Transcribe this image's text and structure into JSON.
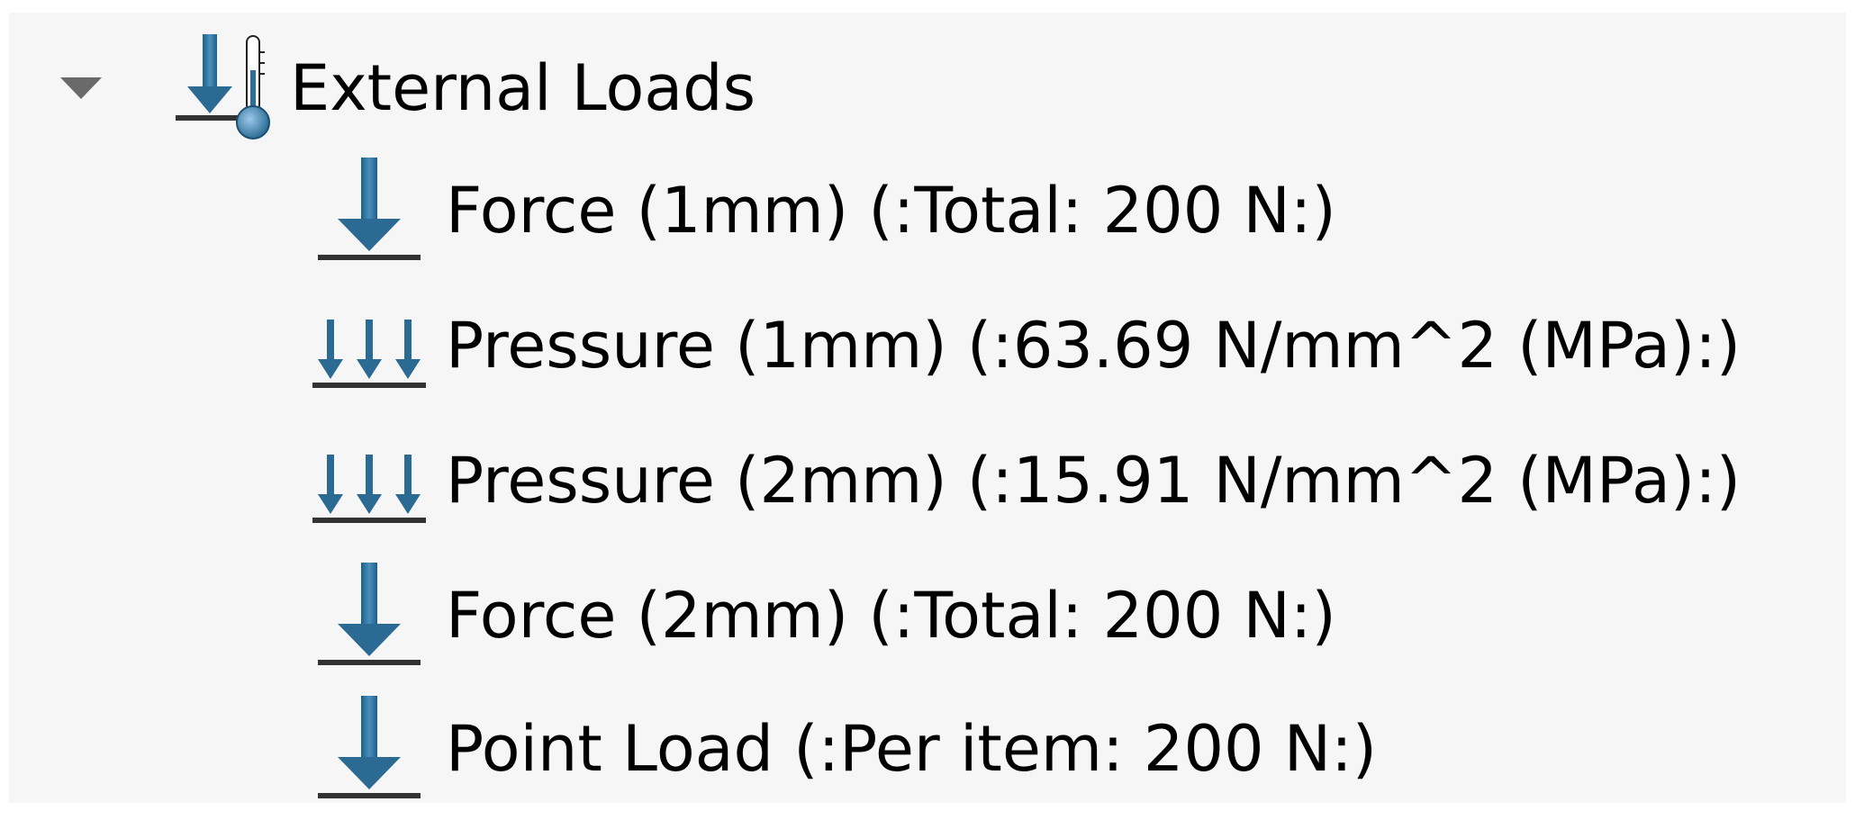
{
  "tree": {
    "root": {
      "label": "External Loads",
      "icon": "external-loads-icon",
      "expanded": true
    },
    "children": [
      {
        "label": "Force (1mm) (:Total: 200 N:)",
        "icon": "force-icon"
      },
      {
        "label": "Pressure (1mm) (:63.69 N/mm^2 (MPa):)",
        "icon": "pressure-icon"
      },
      {
        "label": "Pressure (2mm) (:15.91 N/mm^2 (MPa):)",
        "icon": "pressure-icon"
      },
      {
        "label": "Force (2mm) (:Total: 200 N:)",
        "icon": "force-icon"
      },
      {
        "label": "Point Load (:Per item: 200 N:)",
        "icon": "point-load-icon"
      }
    ]
  },
  "colors": {
    "panel_background": "#f6f6f6",
    "icon_arrow": "#2e6e96",
    "icon_ground": "#333333",
    "thermometer_bulb": "#4f93c3",
    "expander": "#666666"
  }
}
